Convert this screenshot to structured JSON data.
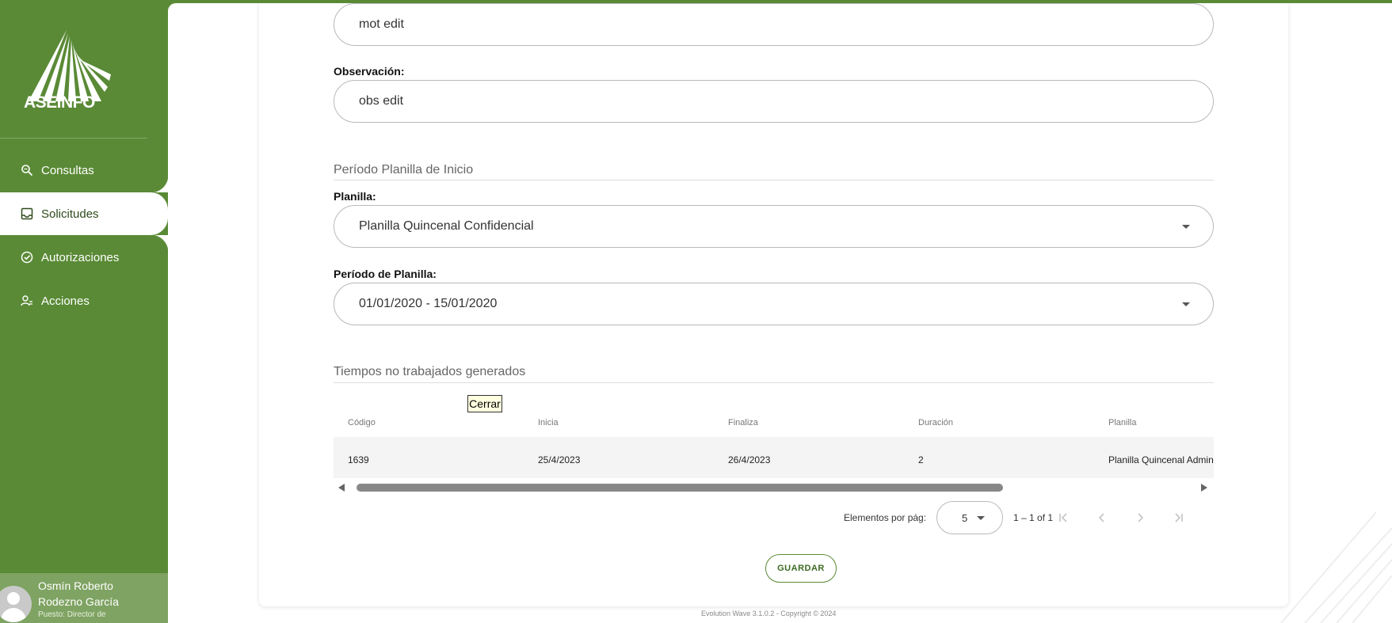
{
  "brand": {
    "logo_text": "ASEINFO",
    "accent": "#5a8a36"
  },
  "sidebar": {
    "items": [
      {
        "label": "Consultas",
        "icon": "search-icon"
      },
      {
        "label": "Solicitudes",
        "icon": "inbox-icon",
        "active": true
      },
      {
        "label": "Autorizaciones",
        "icon": "check-circle-icon"
      },
      {
        "label": "Acciones",
        "icon": "user-settings-icon"
      }
    ]
  },
  "user": {
    "name": "Osmín Roberto Rodezno García",
    "role": "Puesto: Director de"
  },
  "form": {
    "motivo_value": "mot edit",
    "observacion_label": "Observación:",
    "observacion_value": "obs edit",
    "section_periodo": "Período Planilla de Inicio",
    "planilla_label": "Planilla:",
    "planilla_value": "Planilla Quincenal Confidencial",
    "periodo_label": "Período de Planilla:",
    "periodo_value": "01/01/2020 - 15/01/2020"
  },
  "table": {
    "section_title": "Tiempos no trabajados generados",
    "close_label": "Cerrar",
    "headers": [
      "Código",
      "Inicia",
      "Finaliza",
      "Duración",
      "Planilla"
    ],
    "rows": [
      [
        "1639",
        "25/4/2023",
        "26/4/2023",
        "2",
        "Planilla Quincenal Admin"
      ]
    ]
  },
  "paginator": {
    "per_page_label": "Elementos por pág:",
    "per_page_value": "5",
    "range": "1 – 1 of 1"
  },
  "actions": {
    "save_label": "GUARDAR"
  },
  "footer": {
    "text": "Evolution Wave 3.1.0.2 - Copyright © 2024"
  }
}
